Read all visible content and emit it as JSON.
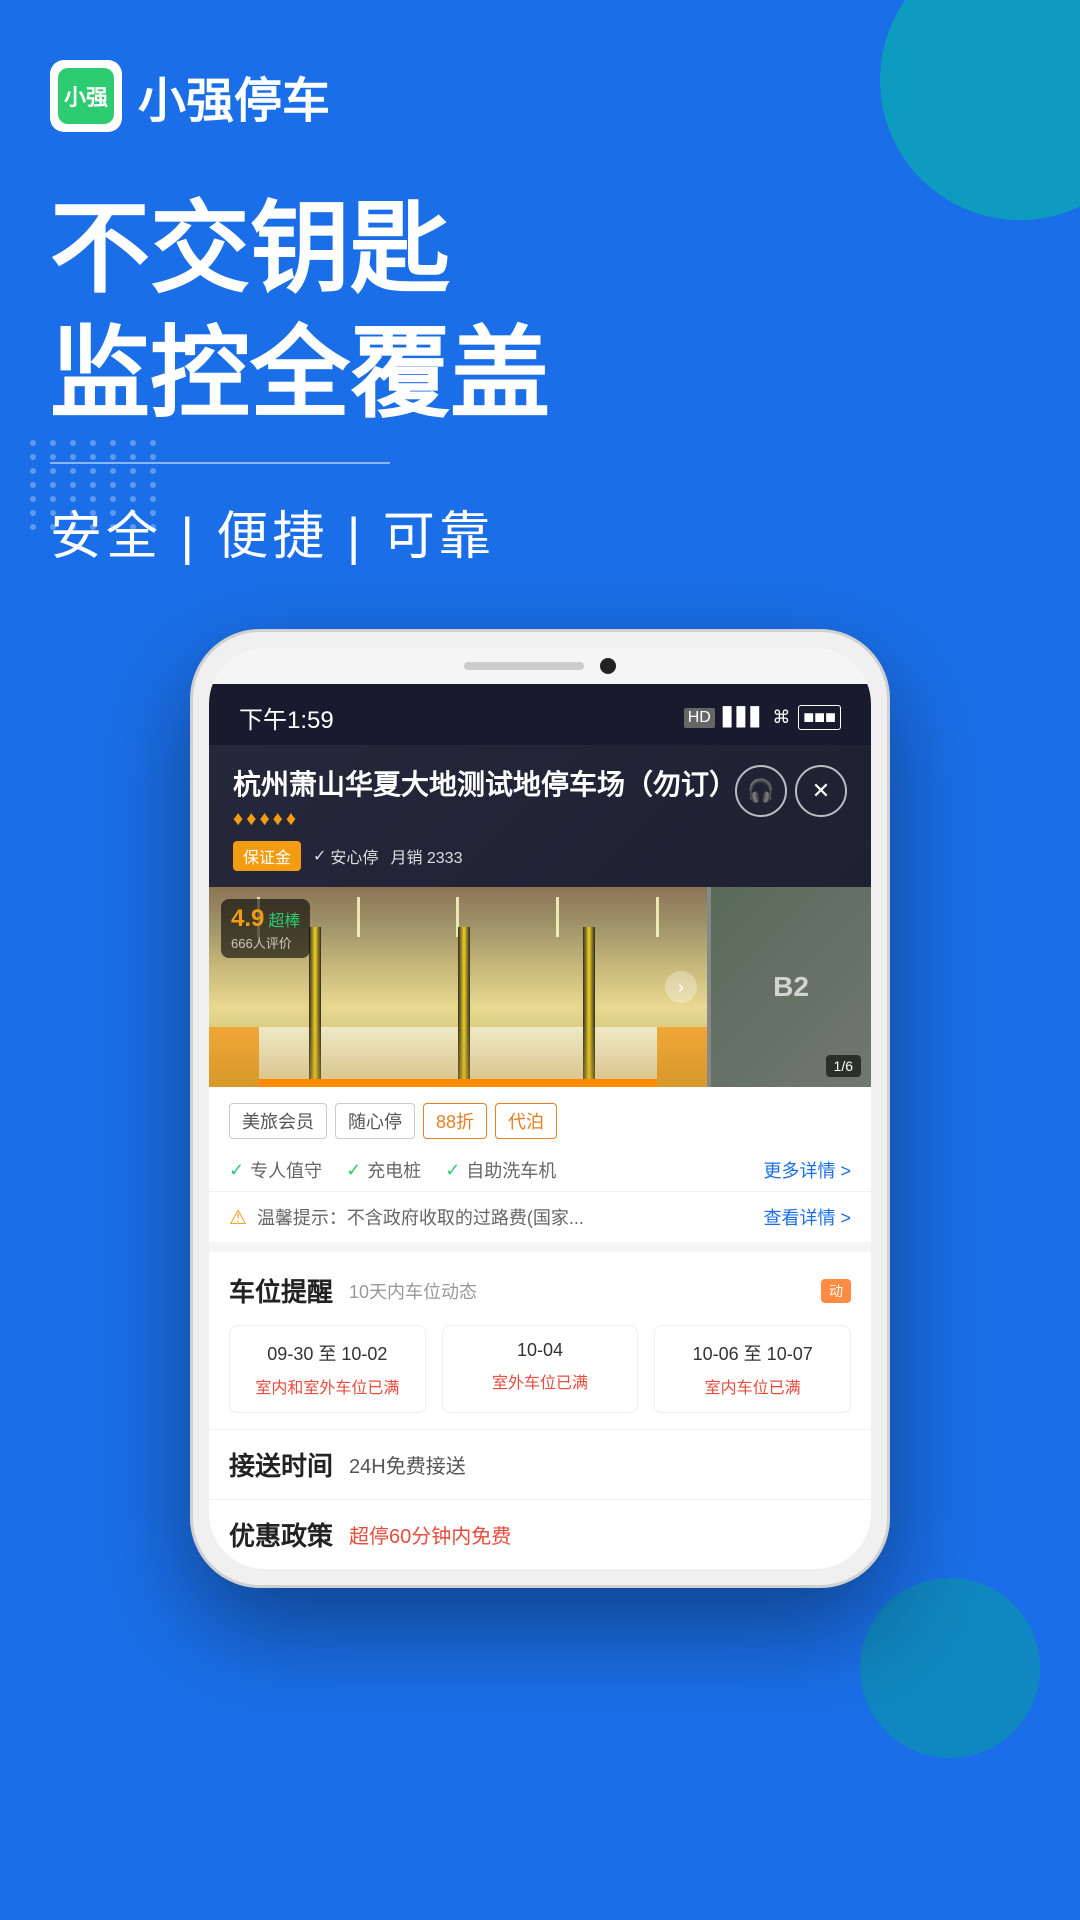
{
  "app": {
    "logo_text": "小强",
    "name": "小强停车"
  },
  "hero": {
    "line1": "不交钥匙",
    "line2": "监控全覆盖",
    "tagline": "安全 | 便捷 | 可靠"
  },
  "status_bar": {
    "time": "下午1:59",
    "hd_label": "HD",
    "battery": "■■"
  },
  "parking": {
    "title": "杭州萧山华夏大地测试地停车场（勿订）",
    "stars": [
      "♦",
      "♦",
      "♦",
      "♦",
      "♦"
    ],
    "tag_guarantee": "保证金",
    "tag_safe": "安心停",
    "monthly_sales": "月销 2333",
    "rating": {
      "score": "4.9",
      "label": "超棒",
      "count": "666人评价"
    },
    "image_counter": "1/6"
  },
  "feature_tags": [
    {
      "label": "美旅会员",
      "special": false
    },
    {
      "label": "随心停",
      "special": false
    },
    {
      "label": "88折",
      "special": false
    },
    {
      "label": "代泊",
      "special": false
    }
  ],
  "amenities": [
    {
      "label": "专人值守"
    },
    {
      "label": "充电桩"
    },
    {
      "label": "自助洗车机"
    }
  ],
  "more_details_label": "更多详情 >",
  "notice": {
    "text": "温馨提示：不含政府收取的过路费(国家...",
    "link": "查看详情 >"
  },
  "reminder": {
    "title": "车位提醒",
    "subtitle": "10天内车位动态",
    "badge": "动态",
    "dates": [
      {
        "range": "09-30 至 10-02",
        "status": "室内和室外车位已满"
      },
      {
        "range": "10-04",
        "status": "室外车位已满"
      },
      {
        "range": "10-06 至 10-07",
        "status": "室内车位已满"
      }
    ]
  },
  "shuttle": {
    "title": "接送时间",
    "value": "24H免费接送"
  },
  "discount": {
    "title": "优惠政策",
    "value": "超停60分钟内免费"
  }
}
